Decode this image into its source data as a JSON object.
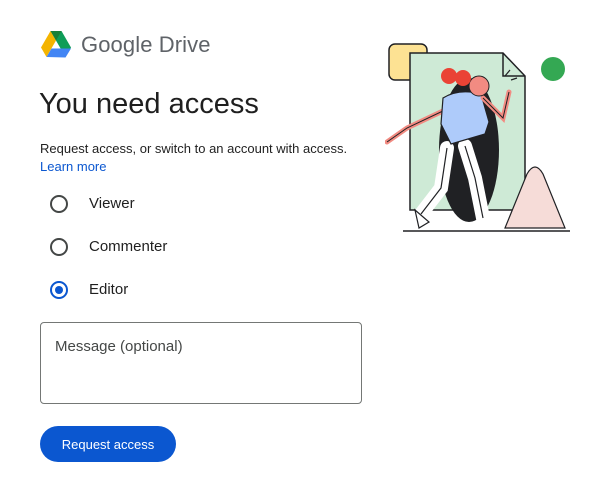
{
  "brand": {
    "app_name": "Google Drive",
    "logo_icon": "google-drive-logo",
    "colors": {
      "green": "#0f9d58",
      "blue": "#4285f4",
      "yellow": "#f4b400"
    }
  },
  "heading": "You need access",
  "subtitle": "Request access, or switch to an account with access.",
  "learn_more": "Learn more",
  "roles": [
    {
      "label": "Viewer",
      "selected": false
    },
    {
      "label": "Commenter",
      "selected": false
    },
    {
      "label": "Editor",
      "selected": true
    }
  ],
  "message": {
    "placeholder": "Message (optional)",
    "value": ""
  },
  "request_button": "Request access",
  "colors": {
    "accent": "#0b57d0",
    "text": "#1f1f1f",
    "muted": "#5f6368"
  }
}
